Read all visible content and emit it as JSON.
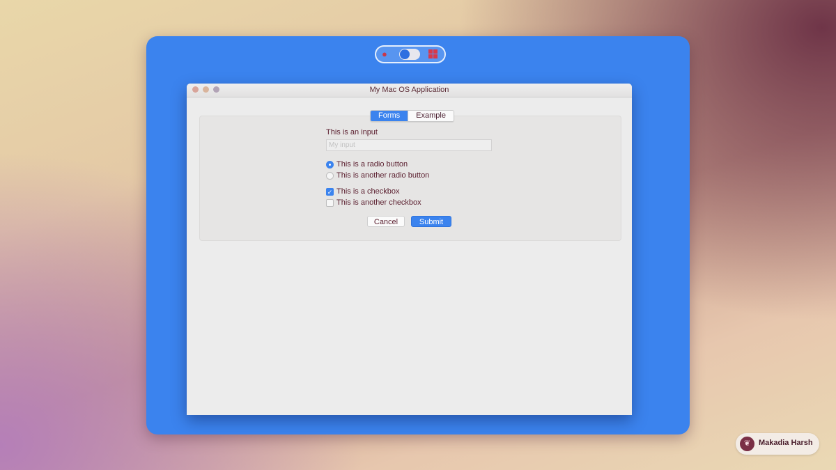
{
  "colors": {
    "accent": "#3b83ee",
    "stage": "#3b83ee",
    "text": "#5a1e2e"
  },
  "switcher": {
    "left_icon": "apple-icon",
    "right_icon": "windows-icon",
    "toggle_state": "mac"
  },
  "window": {
    "title": "My Mac OS Application",
    "tabs": [
      {
        "label": "Forms",
        "active": true
      },
      {
        "label": "Example",
        "active": false
      }
    ]
  },
  "form": {
    "input_label": "This is an input",
    "input_placeholder": "My input",
    "input_value": "",
    "radios": [
      {
        "label": "This is a radio button",
        "checked": true
      },
      {
        "label": "This is another radio button",
        "checked": false
      }
    ],
    "checkboxes": [
      {
        "label": "This is a checkbox",
        "checked": true
      },
      {
        "label": "This is another checkbox",
        "checked": false
      }
    ],
    "cancel_label": "Cancel",
    "submit_label": "Submit"
  },
  "credit": {
    "icon": "twitter-bird-icon",
    "name": "Makadia Harsh"
  }
}
